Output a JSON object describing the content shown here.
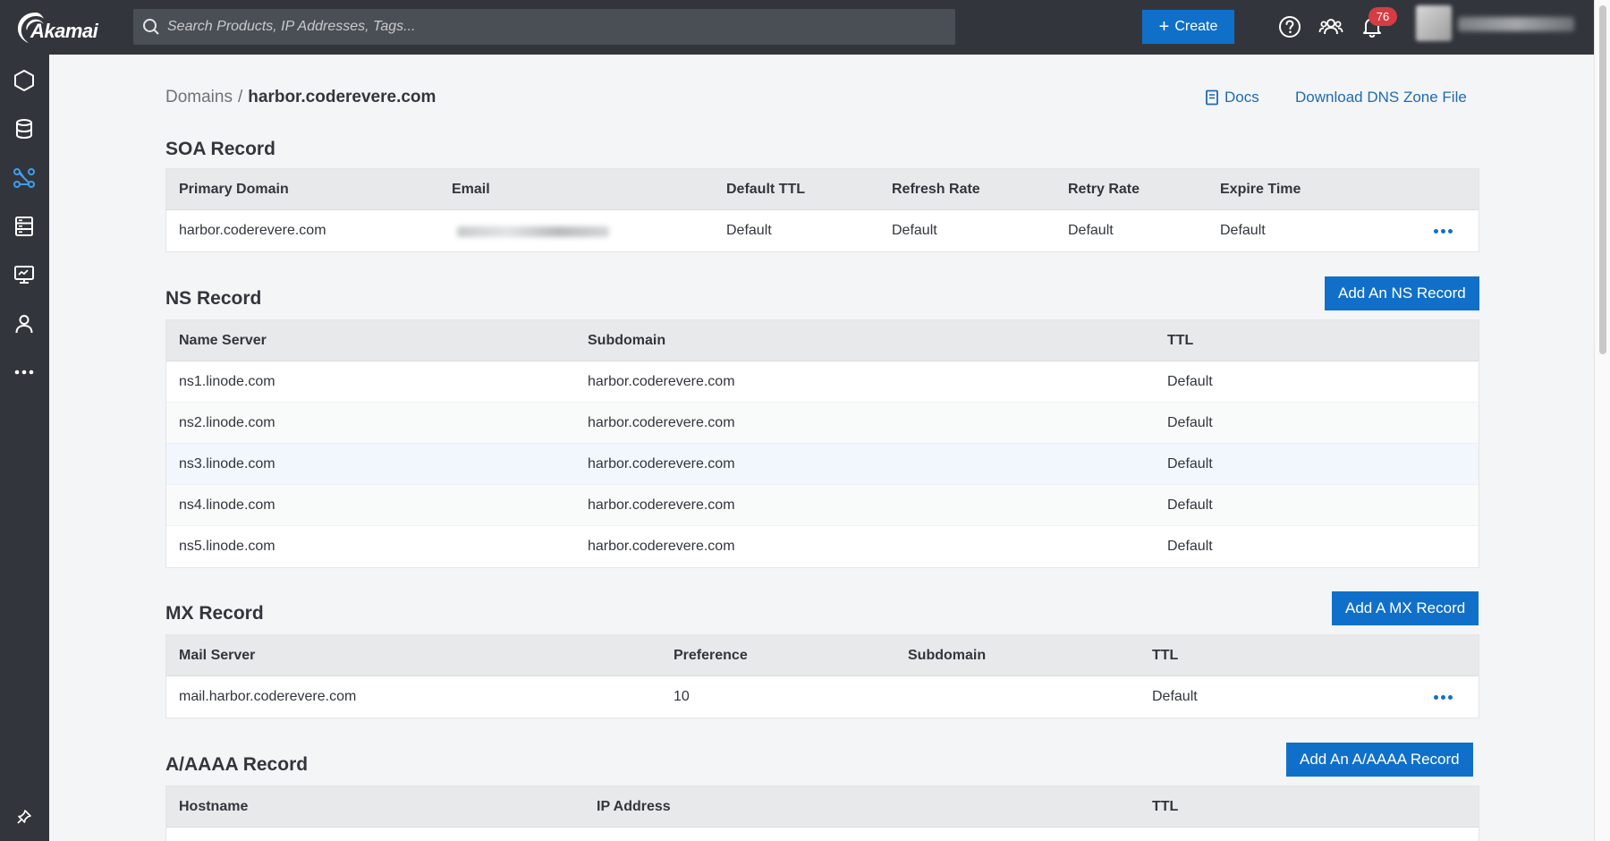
{
  "app": {
    "brand": "Akamai",
    "notifications_count": "76"
  },
  "search": {
    "placeholder": "Search Products, IP Addresses, Tags..."
  },
  "header": {
    "create_label": "Create"
  },
  "breadcrumb": {
    "parent": "Domains",
    "separator": "/",
    "current": "harbor.coderevere.com"
  },
  "actions": {
    "docs_label": "Docs",
    "download_label": "Download DNS Zone File"
  },
  "soa": {
    "title": "SOA Record",
    "headers": [
      "Primary Domain",
      "Email",
      "Default TTL",
      "Refresh Rate",
      "Retry Rate",
      "Expire Time"
    ],
    "row": {
      "primary_domain": "harbor.coderevere.com",
      "default_ttl": "Default",
      "refresh_rate": "Default",
      "retry_rate": "Default",
      "expire_time": "Default"
    }
  },
  "ns": {
    "title": "NS Record",
    "add_label": "Add An NS Record",
    "headers": [
      "Name Server",
      "Subdomain",
      "TTL"
    ],
    "rows": [
      {
        "name_server": "ns1.linode.com",
        "subdomain": "harbor.coderevere.com",
        "ttl": "Default"
      },
      {
        "name_server": "ns2.linode.com",
        "subdomain": "harbor.coderevere.com",
        "ttl": "Default"
      },
      {
        "name_server": "ns3.linode.com",
        "subdomain": "harbor.coderevere.com",
        "ttl": "Default"
      },
      {
        "name_server": "ns4.linode.com",
        "subdomain": "harbor.coderevere.com",
        "ttl": "Default"
      },
      {
        "name_server": "ns5.linode.com",
        "subdomain": "harbor.coderevere.com",
        "ttl": "Default"
      }
    ]
  },
  "mx": {
    "title": "MX Record",
    "add_label": "Add A MX Record",
    "headers": [
      "Mail Server",
      "Preference",
      "Subdomain",
      "TTL"
    ],
    "row": {
      "mail_server": "mail.harbor.coderevere.com",
      "preference": "10",
      "subdomain": "",
      "ttl": "Default"
    }
  },
  "a_aaaa": {
    "title": "A/AAAA Record",
    "add_label": "Add An A/AAAA Record",
    "headers": [
      "Hostname",
      "IP Address",
      "TTL"
    ]
  },
  "colors": {
    "topbar": "#32363c",
    "accent": "#1070c9",
    "link": "#1f6bb2",
    "badge": "#d63c42"
  },
  "icons": {
    "nav": [
      "hexagon-icon",
      "database-icon",
      "network-icon",
      "server-icon",
      "monitor-icon",
      "user-icon",
      "more-icon",
      "pin-icon"
    ],
    "top": [
      "help-icon",
      "community-icon",
      "bell-icon"
    ]
  }
}
